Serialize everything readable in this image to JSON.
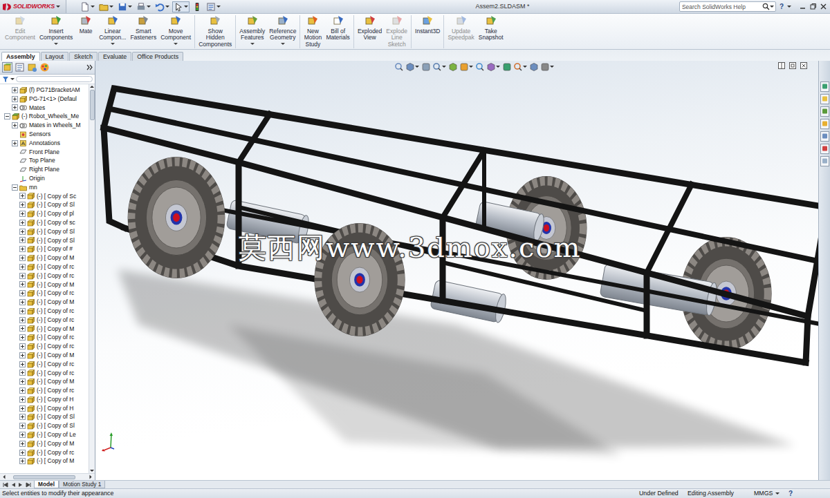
{
  "window": {
    "title": "Assem2.SLDASM *",
    "logo": "SOLIDWORKS"
  },
  "search": {
    "placeholder": "Search SolidWorks Help"
  },
  "help": "?",
  "ribbon": [
    {
      "buttons": [
        {
          "lines": [
            "Edit",
            "Component"
          ],
          "disabled": true,
          "dropdown": false
        },
        {
          "lines": [
            "Insert",
            "Components"
          ],
          "disabled": false,
          "dropdown": true
        },
        {
          "lines": [
            "Mate"
          ],
          "disabled": false,
          "dropdown": false
        },
        {
          "lines": [
            "Linear",
            "Compon..."
          ],
          "disabled": false,
          "dropdown": true
        },
        {
          "lines": [
            "Smart",
            "Fasteners"
          ],
          "disabled": false,
          "dropdown": false
        },
        {
          "lines": [
            "Move",
            "Component"
          ],
          "disabled": false,
          "dropdown": true
        }
      ]
    },
    {
      "buttons": [
        {
          "lines": [
            "Show",
            "Hidden",
            "Components"
          ],
          "disabled": false,
          "dropdown": false
        }
      ]
    },
    {
      "buttons": [
        {
          "lines": [
            "Assembly",
            "Features"
          ],
          "disabled": false,
          "dropdown": true
        },
        {
          "lines": [
            "Reference",
            "Geometry"
          ],
          "disabled": false,
          "dropdown": true
        }
      ]
    },
    {
      "buttons": [
        {
          "lines": [
            "New",
            "Motion",
            "Study"
          ],
          "disabled": false,
          "dropdown": false
        },
        {
          "lines": [
            "Bill of",
            "Materials"
          ],
          "disabled": false,
          "dropdown": false
        }
      ]
    },
    {
      "buttons": [
        {
          "lines": [
            "Exploded",
            "View"
          ],
          "disabled": false,
          "dropdown": false
        },
        {
          "lines": [
            "Explode",
            "Line",
            "Sketch"
          ],
          "disabled": true,
          "dropdown": false
        }
      ]
    },
    {
      "buttons": [
        {
          "lines": [
            "Instant3D"
          ],
          "disabled": false,
          "dropdown": false
        }
      ]
    },
    {
      "buttons": [
        {
          "lines": [
            "Update",
            "Speedpak"
          ],
          "disabled": true,
          "dropdown": false
        },
        {
          "lines": [
            "Take",
            "Snapshot"
          ],
          "disabled": false,
          "dropdown": false
        }
      ]
    }
  ],
  "tabs": [
    {
      "label": "Assembly",
      "selected": true
    },
    {
      "label": "Layout",
      "selected": false
    },
    {
      "label": "Sketch",
      "selected": false
    },
    {
      "label": "Evaluate",
      "selected": false
    },
    {
      "label": "Office Products",
      "selected": false
    }
  ],
  "tree": {
    "items": [
      {
        "label": "(f) PG71BracketAM",
        "kind": "component",
        "depth": 1,
        "expanded": false
      },
      {
        "label": "PG-71<1> (Defaul",
        "kind": "component",
        "depth": 1,
        "expanded": false
      },
      {
        "label": "Mates",
        "kind": "mates",
        "depth": 1,
        "expanded": false
      },
      {
        "label": "(-) Robot_Wheels_Me",
        "kind": "assembly",
        "depth": 0,
        "expanded": true
      },
      {
        "label": "Mates in Wheels_M",
        "kind": "mates",
        "depth": 1,
        "expanded": false
      },
      {
        "label": "Sensors",
        "kind": "sensor",
        "depth": 1
      },
      {
        "label": "Annotations",
        "kind": "annotation",
        "depth": 1,
        "expanded": false
      },
      {
        "label": "Front Plane",
        "kind": "plane",
        "depth": 1
      },
      {
        "label": "Top Plane",
        "kind": "plane",
        "depth": 1
      },
      {
        "label": "Right Plane",
        "kind": "plane",
        "depth": 1
      },
      {
        "label": "Origin",
        "kind": "origin",
        "depth": 1
      },
      {
        "label": "mn",
        "kind": "folder",
        "depth": 1,
        "expanded": true
      },
      {
        "label": "(-) [ Copy of Sc",
        "kind": "component",
        "depth": 2,
        "expanded": false
      },
      {
        "label": "(-) [ Copy of Sl",
        "kind": "component",
        "depth": 2,
        "expanded": false
      },
      {
        "label": "(-) [ Copy of pl",
        "kind": "component",
        "depth": 2,
        "expanded": false
      },
      {
        "label": "(-) [ Copy of sc",
        "kind": "component",
        "depth": 2,
        "expanded": false
      },
      {
        "label": "(-) [ Copy of Sl",
        "kind": "component",
        "depth": 2,
        "expanded": false
      },
      {
        "label": "(-) [ Copy of Sl",
        "kind": "component",
        "depth": 2,
        "expanded": false
      },
      {
        "label": "(-) [ Copy of #",
        "kind": "component",
        "depth": 2,
        "expanded": false
      },
      {
        "label": "(-) [ Copy of M",
        "kind": "component",
        "depth": 2,
        "expanded": false
      },
      {
        "label": "(-) [ Copy of rc",
        "kind": "component",
        "depth": 2,
        "expanded": false
      },
      {
        "label": "(-) [ Copy of rc",
        "kind": "component",
        "depth": 2,
        "expanded": false
      },
      {
        "label": "(-) [ Copy of M",
        "kind": "component",
        "depth": 2,
        "expanded": false
      },
      {
        "label": "(-) [ Copy of rc",
        "kind": "component",
        "depth": 2,
        "expanded": false
      },
      {
        "label": "(-) [ Copy of M",
        "kind": "component",
        "depth": 2,
        "expanded": false
      },
      {
        "label": "(-) [ Copy of rc",
        "kind": "component",
        "depth": 2,
        "expanded": false
      },
      {
        "label": "(-) [ Copy of rc",
        "kind": "component",
        "depth": 2,
        "expanded": false
      },
      {
        "label": "(-) [ Copy of M",
        "kind": "component",
        "depth": 2,
        "expanded": false
      },
      {
        "label": "(-) [ Copy of rc",
        "kind": "component",
        "depth": 2,
        "expanded": false
      },
      {
        "label": "(-) [ Copy of rc",
        "kind": "component",
        "depth": 2,
        "expanded": false
      },
      {
        "label": "(-) [ Copy of M",
        "kind": "component",
        "depth": 2,
        "expanded": false
      },
      {
        "label": "(-) [ Copy of rc",
        "kind": "component",
        "depth": 2,
        "expanded": false
      },
      {
        "label": "(-) [ Copy of rc",
        "kind": "component",
        "depth": 2,
        "expanded": false
      },
      {
        "label": "(-) [ Copy of M",
        "kind": "component",
        "depth": 2,
        "expanded": false
      },
      {
        "label": "(-) [ Copy of rc",
        "kind": "component",
        "depth": 2,
        "expanded": false
      },
      {
        "label": "(-) [ Copy of H",
        "kind": "component",
        "depth": 2,
        "expanded": false
      },
      {
        "label": "(-) [ Copy of H",
        "kind": "component",
        "depth": 2,
        "expanded": false
      },
      {
        "label": "(-) [ Copy of Sl",
        "kind": "component",
        "depth": 2,
        "expanded": false
      },
      {
        "label": "(-) [ Copy of Sl",
        "kind": "component",
        "depth": 2,
        "expanded": false
      },
      {
        "label": "(-) [ Copy of Le",
        "kind": "component",
        "depth": 2,
        "expanded": false
      },
      {
        "label": "(-) [ Copy of M",
        "kind": "component",
        "depth": 2,
        "expanded": false
      },
      {
        "label": "(-) [ Copy of rc",
        "kind": "component",
        "depth": 2,
        "expanded": false
      },
      {
        "label": "(-) [ Copy of M",
        "kind": "component",
        "depth": 2,
        "expanded": false
      }
    ]
  },
  "watermark": "莫西网www.3dmox.com",
  "bottom_tabs": [
    {
      "label": "Model",
      "selected": true
    },
    {
      "label": "Motion Study 1",
      "selected": false
    }
  ],
  "status_bar": {
    "message": "Select entities to modify their appearance",
    "state": "Under Defined",
    "mode": "Editing Assembly",
    "units": "MMGS",
    "help": "?"
  }
}
